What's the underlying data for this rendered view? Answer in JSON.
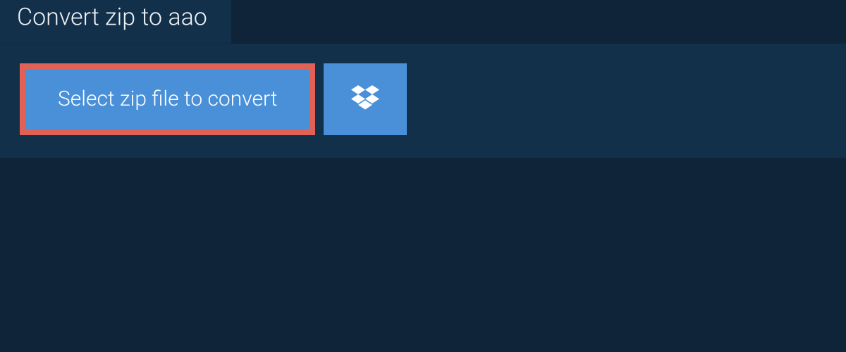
{
  "header": {
    "title": "Convert zip to aao"
  },
  "actions": {
    "select_label": "Select zip file to convert"
  },
  "colors": {
    "page_bg": "#0f2438",
    "panel_bg": "#13304b",
    "button_bg": "#4a90d9",
    "button_border": "#e06257",
    "text_light": "#ffffff"
  }
}
